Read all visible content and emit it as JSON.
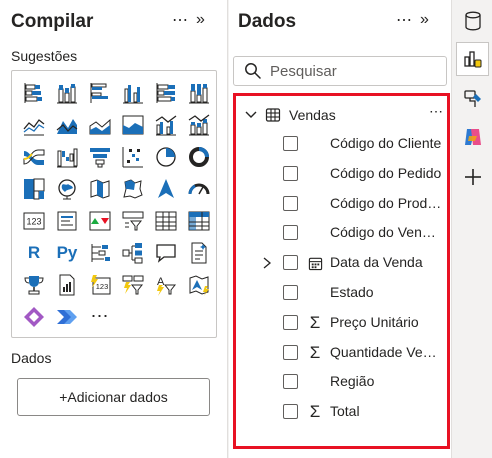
{
  "build": {
    "title": "Compilar",
    "more": "⋯",
    "collapse": "»",
    "suggestions_label": "Sugestões",
    "data_label": "Dados",
    "add_data_label": "+Adicionar dados",
    "visuals": [
      {
        "icon": "stacked-bar-chart-icon"
      },
      {
        "icon": "stacked-column-chart-icon"
      },
      {
        "icon": "clustered-bar-chart-icon"
      },
      {
        "icon": "clustered-column-chart-icon"
      },
      {
        "icon": "100-stacked-bar-chart-icon"
      },
      {
        "icon": "100-stacked-column-chart-icon"
      },
      {
        "icon": "line-chart-icon"
      },
      {
        "icon": "area-chart-icon"
      },
      {
        "icon": "stacked-area-chart-icon"
      },
      {
        "icon": "100-stacked-area-chart-icon"
      },
      {
        "icon": "line-clustered-column-chart-icon"
      },
      {
        "icon": "line-stacked-column-chart-icon"
      },
      {
        "icon": "ribbon-chart-icon"
      },
      {
        "icon": "waterfall-chart-icon"
      },
      {
        "icon": "funnel-chart-icon"
      },
      {
        "icon": "scatter-chart-icon"
      },
      {
        "icon": "pie-chart-icon"
      },
      {
        "icon": "donut-chart-icon"
      },
      {
        "icon": "treemap-icon"
      },
      {
        "icon": "globe-map-icon"
      },
      {
        "icon": "filled-map-icon"
      },
      {
        "icon": "shape-map-icon"
      },
      {
        "icon": "azure-map-icon"
      },
      {
        "icon": "gauge-icon"
      },
      {
        "icon": "card-icon",
        "text": "123"
      },
      {
        "icon": "multi-row-card-icon"
      },
      {
        "icon": "kpi-icon"
      },
      {
        "icon": "slicer-icon"
      },
      {
        "icon": "table-icon"
      },
      {
        "icon": "matrix-icon"
      },
      {
        "icon": "r-visual-icon",
        "text": "R"
      },
      {
        "icon": "python-visual-icon",
        "text": "Py"
      },
      {
        "icon": "key-influencers-icon"
      },
      {
        "icon": "decomposition-tree-icon"
      },
      {
        "icon": "qna-icon"
      },
      {
        "icon": "smart-narrative-icon"
      },
      {
        "icon": "trophy-icon"
      },
      {
        "icon": "paginated-report-icon"
      },
      {
        "icon": "new-card-icon"
      },
      {
        "icon": "button-slicer-icon"
      },
      {
        "icon": "text-slicer-icon"
      },
      {
        "icon": "azure-map-visual-icon"
      },
      {
        "icon": "power-apps-icon"
      },
      {
        "icon": "power-automate-icon"
      },
      {
        "icon": "more-visuals-icon",
        "text": "⋯"
      }
    ]
  },
  "data": {
    "title": "Dados",
    "more": "⋯",
    "collapse": "»",
    "search_placeholder": "Pesquisar",
    "table": {
      "name": "Vendas",
      "more": "⋯"
    },
    "fields": [
      {
        "label": "Código do Cliente",
        "type": "text"
      },
      {
        "label": "Código do Pedido",
        "type": "text"
      },
      {
        "label": "Código do Produto",
        "type": "text"
      },
      {
        "label": "Código do Vendedor",
        "type": "text"
      },
      {
        "label": "Data da Venda",
        "type": "date",
        "expandable": true
      },
      {
        "label": "Estado",
        "type": "text"
      },
      {
        "label": "Preço Unitário",
        "type": "sum",
        "symbol": "Σ"
      },
      {
        "label": "Quantidade Vendida",
        "type": "sum",
        "symbol": "Σ"
      },
      {
        "label": "Região",
        "type": "text"
      },
      {
        "label": "Total",
        "type": "sum",
        "symbol": "Σ"
      }
    ]
  },
  "rail": {
    "items": [
      {
        "icon": "data-cylinder-icon",
        "active": false
      },
      {
        "icon": "build-visual-icon",
        "active": true
      },
      {
        "icon": "format-brush-icon",
        "active": false
      },
      {
        "icon": "copilot-icon",
        "active": false
      },
      {
        "icon": "add-pane-icon",
        "active": false
      }
    ]
  },
  "colors": {
    "accent_blue": "#1b6fb8",
    "highlight_red": "#e81123",
    "viz_yellow": "#f2c80f",
    "pane_bg": "#ffffff",
    "rail_bg": "#f3f2f1"
  }
}
